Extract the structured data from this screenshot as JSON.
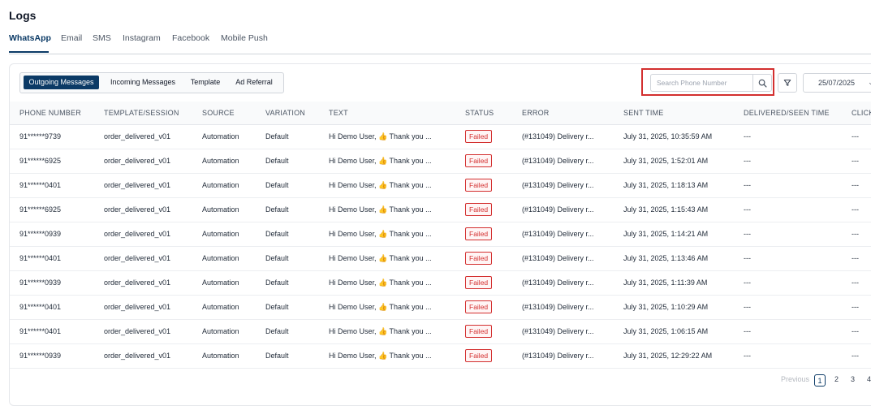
{
  "page": {
    "title": "Logs"
  },
  "channel_tabs": [
    {
      "label": "WhatsApp",
      "active": true
    },
    {
      "label": "Email"
    },
    {
      "label": "SMS"
    },
    {
      "label": "Instagram"
    },
    {
      "label": "Facebook"
    },
    {
      "label": "Mobile Push"
    }
  ],
  "message_tabs": [
    {
      "label": "Outgoing Messages",
      "active": true
    },
    {
      "label": "Incoming Messages"
    },
    {
      "label": "Template"
    },
    {
      "label": "Ad Referral"
    }
  ],
  "search": {
    "placeholder": "Search Phone Number",
    "value": ""
  },
  "date_filter": {
    "value": "25/07/2025"
  },
  "table": {
    "columns": [
      "PHONE NUMBER",
      "TEMPLATE/SESSION",
      "SOURCE",
      "VARIATION",
      "TEXT",
      "STATUS",
      "ERROR",
      "SENT TIME",
      "DELIVERED/SEEN TIME",
      "CLICK"
    ],
    "rows": [
      {
        "phone": "91******9739",
        "template": "order_delivered_v01",
        "source": "Automation",
        "variation": "Default",
        "text": "Hi Demo User, 👍 Thank you ...",
        "status": "Failed",
        "error": "(#131049) Delivery r...",
        "sent": "July 31, 2025, 10:35:59 AM",
        "delivered": "---",
        "click": "---"
      },
      {
        "phone": "91******6925",
        "template": "order_delivered_v01",
        "source": "Automation",
        "variation": "Default",
        "text": "Hi Demo User, 👍 Thank you ...",
        "status": "Failed",
        "error": "(#131049) Delivery r...",
        "sent": "July 31, 2025, 1:52:01 AM",
        "delivered": "---",
        "click": "---"
      },
      {
        "phone": "91******0401",
        "template": "order_delivered_v01",
        "source": "Automation",
        "variation": "Default",
        "text": "Hi Demo User, 👍 Thank you ...",
        "status": "Failed",
        "error": "(#131049) Delivery r...",
        "sent": "July 31, 2025, 1:18:13 AM",
        "delivered": "---",
        "click": "---"
      },
      {
        "phone": "91******6925",
        "template": "order_delivered_v01",
        "source": "Automation",
        "variation": "Default",
        "text": "Hi Demo User, 👍 Thank you ...",
        "status": "Failed",
        "error": "(#131049) Delivery r...",
        "sent": "July 31, 2025, 1:15:43 AM",
        "delivered": "---",
        "click": "---"
      },
      {
        "phone": "91******0939",
        "template": "order_delivered_v01",
        "source": "Automation",
        "variation": "Default",
        "text": "Hi Demo User, 👍 Thank you ...",
        "status": "Failed",
        "error": "(#131049) Delivery r...",
        "sent": "July 31, 2025, 1:14:21 AM",
        "delivered": "---",
        "click": "---"
      },
      {
        "phone": "91******0401",
        "template": "order_delivered_v01",
        "source": "Automation",
        "variation": "Default",
        "text": "Hi Demo User, 👍 Thank you ...",
        "status": "Failed",
        "error": "(#131049) Delivery r...",
        "sent": "July 31, 2025, 1:13:46 AM",
        "delivered": "---",
        "click": "---"
      },
      {
        "phone": "91******0939",
        "template": "order_delivered_v01",
        "source": "Automation",
        "variation": "Default",
        "text": "Hi Demo User, 👍 Thank you ...",
        "status": "Failed",
        "error": "(#131049) Delivery r...",
        "sent": "July 31, 2025, 1:11:39 AM",
        "delivered": "---",
        "click": "---"
      },
      {
        "phone": "91******0401",
        "template": "order_delivered_v01",
        "source": "Automation",
        "variation": "Default",
        "text": "Hi Demo User, 👍 Thank you ...",
        "status": "Failed",
        "error": "(#131049) Delivery r...",
        "sent": "July 31, 2025, 1:10:29 AM",
        "delivered": "---",
        "click": "---"
      },
      {
        "phone": "91******0401",
        "template": "order_delivered_v01",
        "source": "Automation",
        "variation": "Default",
        "text": "Hi Demo User, 👍 Thank you ...",
        "status": "Failed",
        "error": "(#131049) Delivery r...",
        "sent": "July 31, 2025, 1:06:15 AM",
        "delivered": "---",
        "click": "---"
      },
      {
        "phone": "91******0939",
        "template": "order_delivered_v01",
        "source": "Automation",
        "variation": "Default",
        "text": "Hi Demo User, 👍 Thank you ...",
        "status": "Failed",
        "error": "(#131049) Delivery r...",
        "sent": "July 31, 2025, 12:29:22 AM",
        "delivered": "---",
        "click": "---"
      }
    ]
  },
  "pagination": {
    "previous": "Previous",
    "pages": [
      "1",
      "2",
      "3",
      "4"
    ],
    "current": "1"
  },
  "colors": {
    "accent": "#0b3a66",
    "failed": "#d32f2f",
    "highlight": "#d32f2f"
  },
  "icons": {
    "search": "search-icon",
    "filter": "filter-icon",
    "date": "chevron-down-icon"
  }
}
